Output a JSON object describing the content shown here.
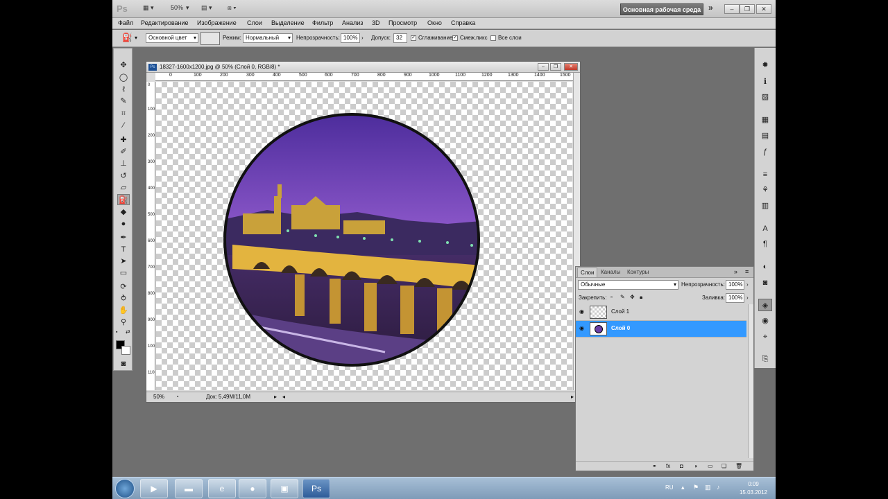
{
  "app": {
    "logo": "Ps",
    "zoom_select": "50%",
    "workspace": "Основная рабочая среда"
  },
  "menu": [
    "Файл",
    "Редактирование",
    "Изображение",
    "Слои",
    "Выделение",
    "Фильтр",
    "Анализ",
    "3D",
    "Просмотр",
    "Окно",
    "Справка"
  ],
  "options": {
    "source_label": "Основной цвет",
    "mode_label": "Режим:",
    "mode_value": "Нормальный",
    "opacity_label": "Непрозрачность:",
    "opacity_value": "100%",
    "tolerance_label": "Допуск:",
    "tolerance_value": "32",
    "antialias_label": "Сглаживание",
    "contiguous_label": "Смеж.пикс",
    "all_layers_label": "Все слои"
  },
  "document": {
    "icon_text": "Ps",
    "title": "18327-1600x1200.jpg @ 50% (Слой 0, RGB/8) *",
    "ruler_top": [
      "0",
      "100",
      "200",
      "300",
      "400",
      "500",
      "600",
      "700",
      "800",
      "900",
      "1000",
      "1100",
      "1200",
      "1300",
      "1400",
      "1500"
    ],
    "ruler_left": [
      "0",
      "100",
      "200",
      "300",
      "400",
      "500",
      "600",
      "700",
      "800",
      "900",
      "1000",
      "1100",
      "1200"
    ],
    "zoom": "50%",
    "doc_info": "Док: 5,49M/11,0M"
  },
  "layers_panel": {
    "tabs": [
      "Слои",
      "Каналы",
      "Контуры"
    ],
    "blend_mode": "Обычные",
    "opacity_label": "Непрозрачность:",
    "opacity_value": "100%",
    "lock_label": "Закрепить:",
    "fill_label": "Заливка:",
    "fill_value": "100%",
    "layers": [
      {
        "name": "Слой 1",
        "selected": false
      },
      {
        "name": "Слой 0",
        "selected": true
      }
    ]
  },
  "taskbar": {
    "lang": "RU",
    "time": "0:09",
    "date": "15.03.2012"
  },
  "colors": {
    "selection": "#3399ff",
    "sky_top": "#5a2fa0",
    "sky_mid": "#8a56c8"
  }
}
